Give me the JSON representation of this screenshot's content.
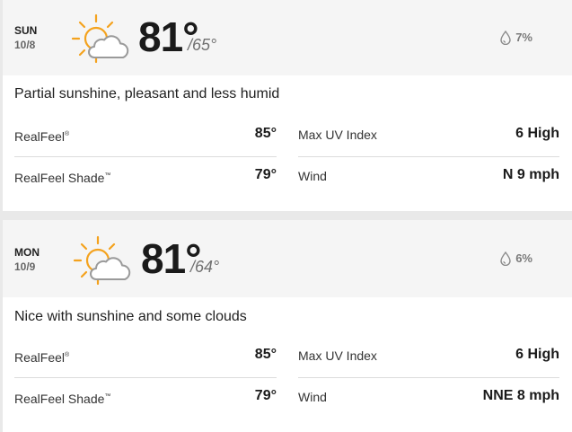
{
  "forecast": [
    {
      "day": "SUN",
      "date": "10/8",
      "icon": "partly-sunny-icon",
      "high": "81°",
      "low": "/65°",
      "precip": "7%",
      "phrase": "Partial sunshine, pleasant and less humid",
      "realfeel_label": "RealFeel",
      "realfeel_mark": "®",
      "realfeel": "85°",
      "realfeel_shade_label": "RealFeel Shade",
      "realfeel_shade_mark": "™",
      "realfeel_shade": "79°",
      "uv_label": "Max UV Index",
      "uv": "6 High",
      "wind_label": "Wind",
      "wind": "N 9 mph"
    },
    {
      "day": "MON",
      "date": "10/9",
      "icon": "partly-sunny-icon",
      "high": "81°",
      "low": "/64°",
      "precip": "6%",
      "phrase": "Nice with sunshine and some clouds",
      "realfeel_label": "RealFeel",
      "realfeel_mark": "®",
      "realfeel": "85°",
      "realfeel_shade_label": "RealFeel Shade",
      "realfeel_shade_mark": "™",
      "realfeel_shade": "79°",
      "uv_label": "Max UV Index",
      "uv": "6 High",
      "wind_label": "Wind",
      "wind": "NNE 8 mph"
    }
  ],
  "colors": {
    "sun": "#f4a21d",
    "cloud_stroke": "#9a9a9a",
    "cloud_fill": "#ffffff",
    "header_bg": "#f5f5f5"
  }
}
